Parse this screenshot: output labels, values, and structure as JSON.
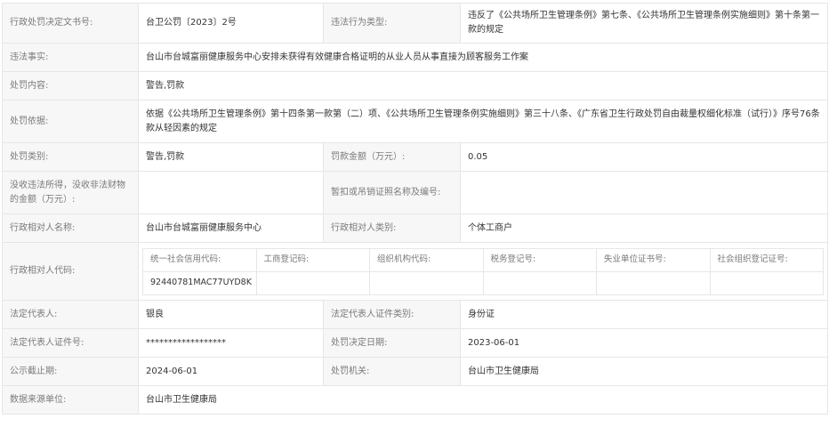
{
  "record": {
    "decision_no": {
      "label": "行政处罚决定文书号:",
      "value": "台卫公罚〔2023〕2号"
    },
    "violation_type": {
      "label": "违法行为类型:",
      "value": "违反了《公共场所卫生管理条例》第七条、《公共场所卫生管理条例实施细则》第十条第一款的规定"
    },
    "facts": {
      "label": "违法事实:",
      "value": "台山市台城富丽健康服务中心安排未获得有效健康合格证明的从业人员从事直接为顾客服务工作案"
    },
    "penalty_content": {
      "label": "处罚内容:",
      "value": "警告,罚款"
    },
    "basis": {
      "label": "处罚依据:",
      "value": "依据《公共场所卫生管理条例》第十四条第一款第（二）项、《公共场所卫生管理条例实施细则》第三十八条、《广东省卫生行政处罚自由裁量权细化标准（试行）》序号76条款从轻因素的规定"
    },
    "penalty_category": {
      "label": "处罚类别:",
      "value": "警告,罚款"
    },
    "fine_amount": {
      "label": "罚款金额（万元）:",
      "value": "0.05"
    },
    "confiscated": {
      "label": "没收违法所得，没收非法财物的金额（万元）:",
      "value": ""
    },
    "license_suspend": {
      "label": "暂扣或吊销证照名称及编号:",
      "value": ""
    },
    "party_name": {
      "label": "行政相对人名称:",
      "value": "台山市台城富丽健康服务中心"
    },
    "party_type": {
      "label": "行政相对人类别:",
      "value": "个体工商户"
    },
    "party_codes": {
      "label": "行政相对人代码:",
      "headers": [
        "统一社会信用代码:",
        "工商登记码:",
        "组织机构代码:",
        "税务登记号:",
        "失业单位证书号:",
        "社会组织登记证号:"
      ],
      "values": [
        "92440781MAC77UYD8K",
        "",
        "",
        "",
        "",
        ""
      ]
    },
    "legal_rep": {
      "label": "法定代表人:",
      "value": "银良"
    },
    "legal_rep_id_type": {
      "label": "法定代表人证件类别:",
      "value": "身份证"
    },
    "legal_rep_id_no": {
      "label": "法定代表人证件号:",
      "value": "******************"
    },
    "decision_date": {
      "label": "处罚决定日期:",
      "value": "2023-06-01"
    },
    "publish_deadline": {
      "label": "公示截止期:",
      "value": "2024-06-01"
    },
    "authority": {
      "label": "处罚机关:",
      "value": "台山市卫生健康局"
    },
    "data_source": {
      "label": "数据来源单位:",
      "value": "台山市卫生健康局"
    }
  }
}
